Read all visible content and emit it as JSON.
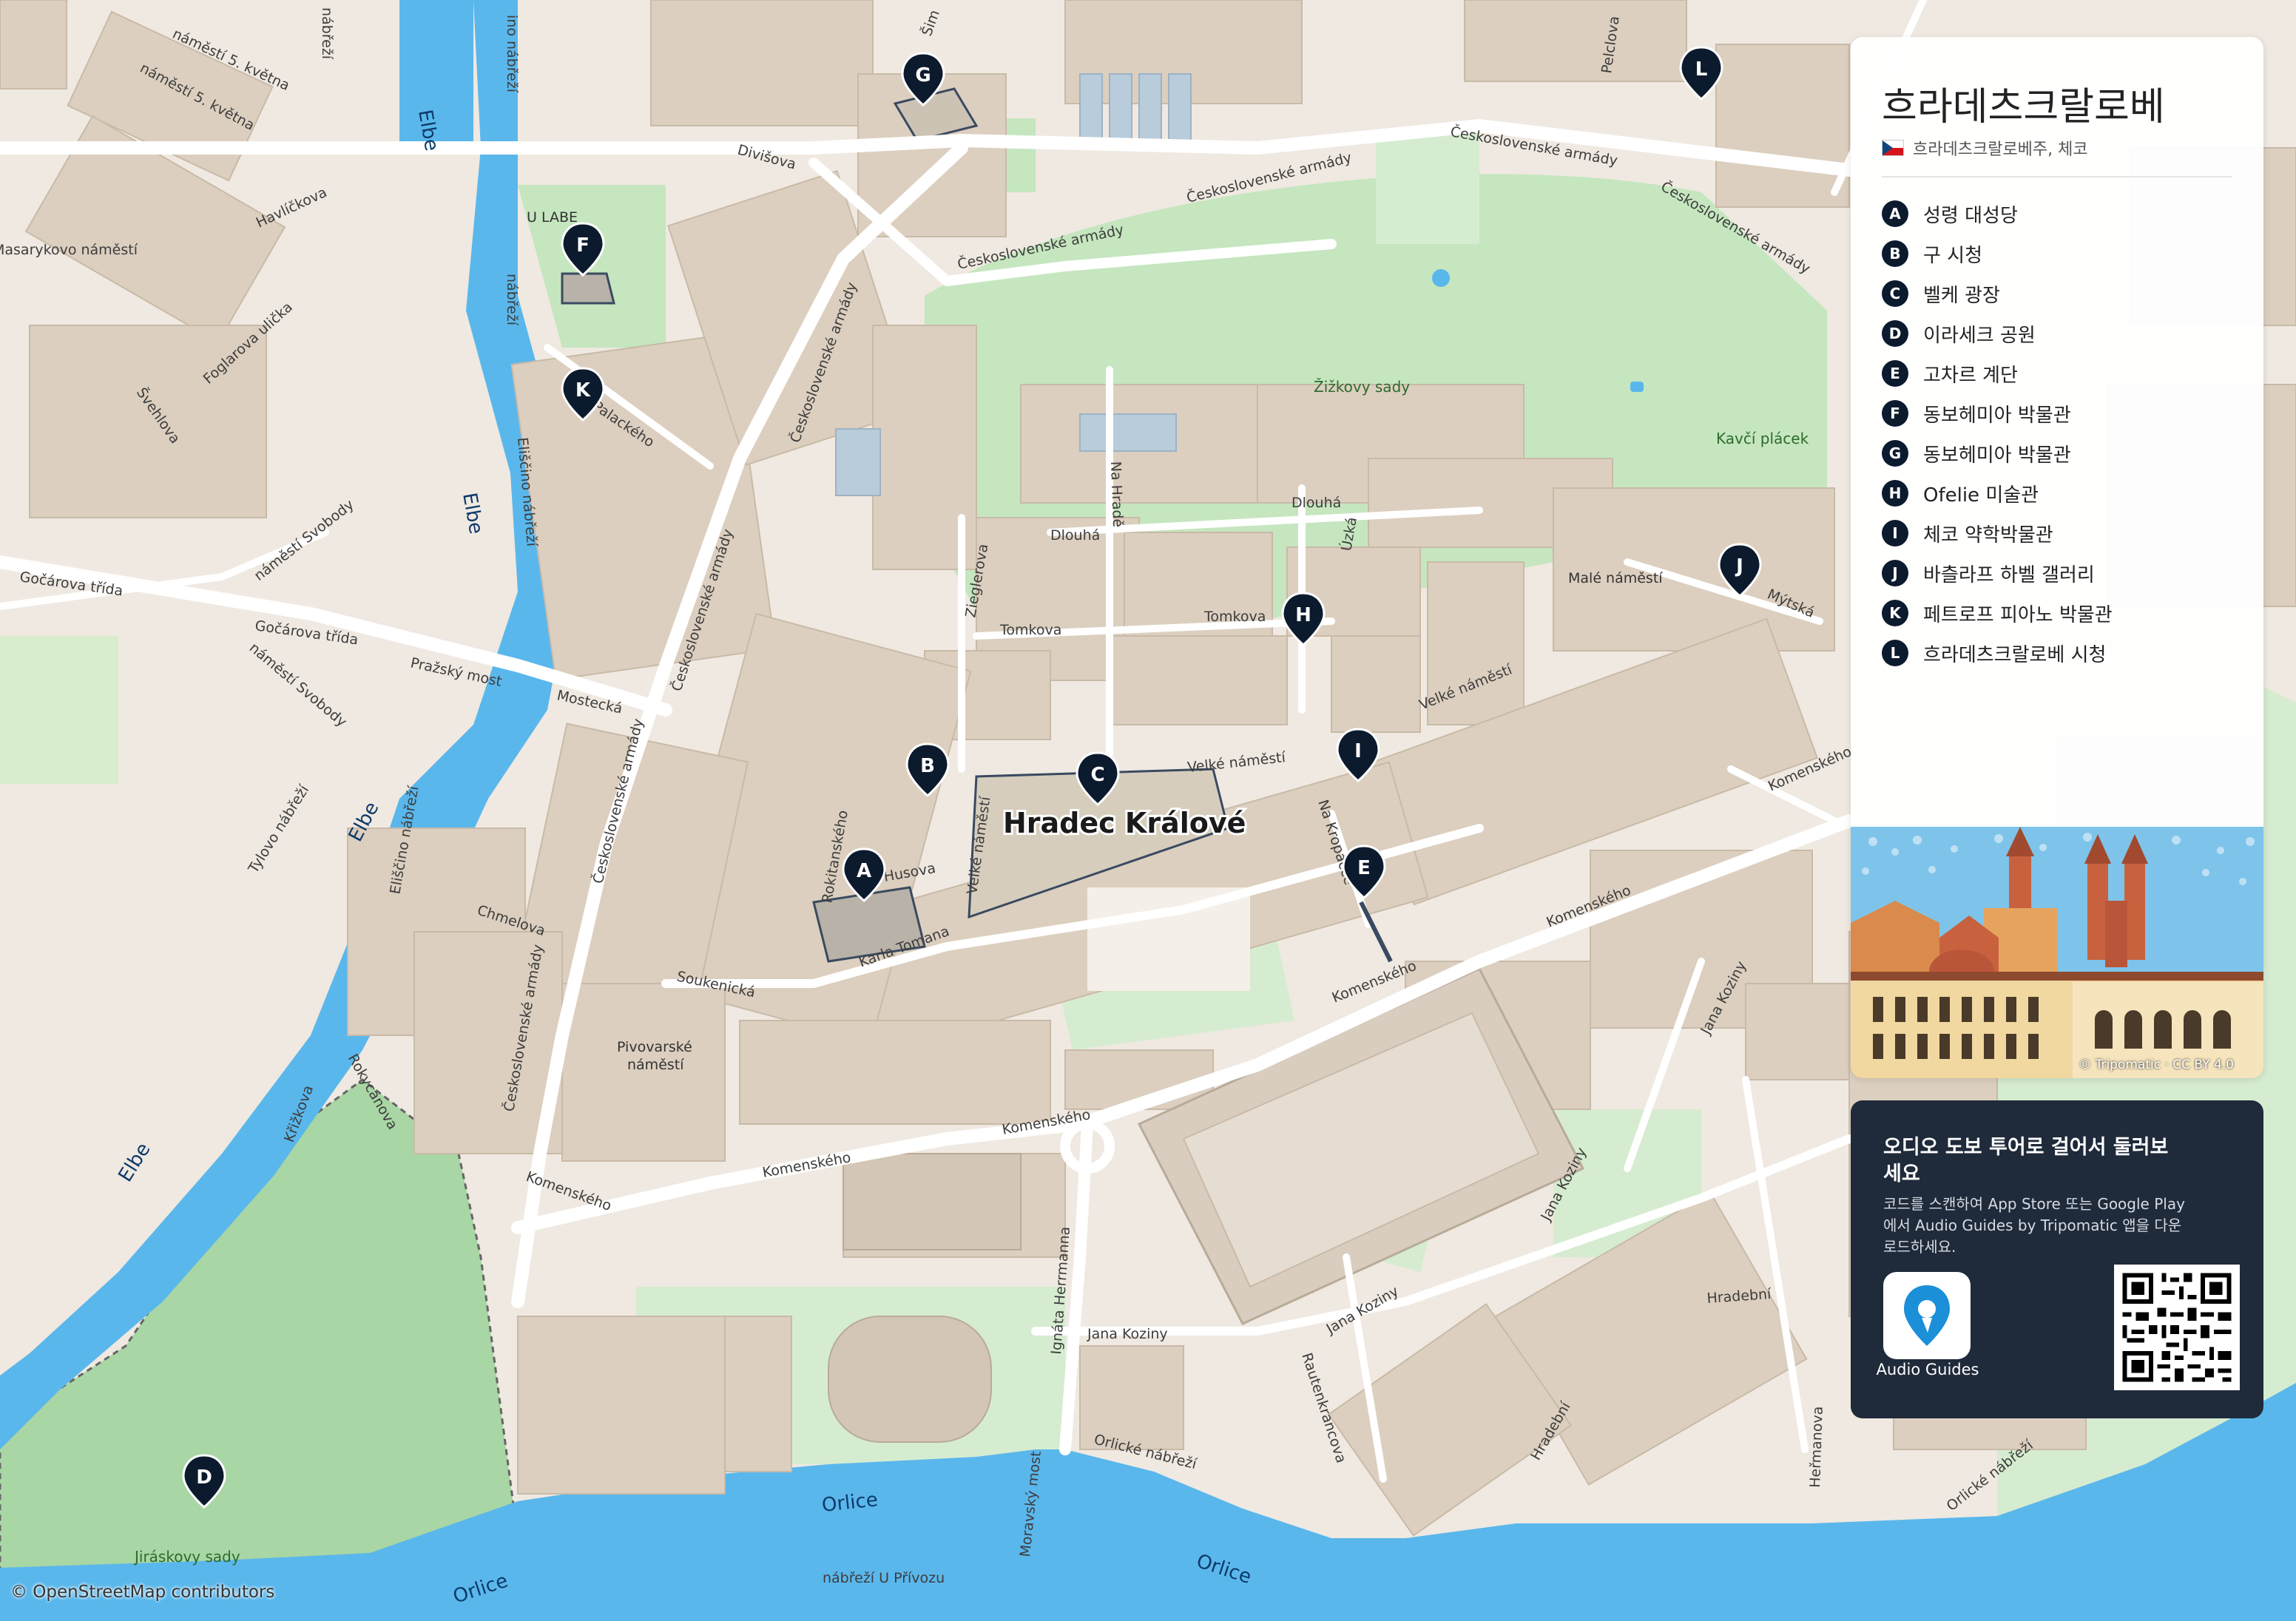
{
  "map": {
    "city_label": "Hradec Králové",
    "streets": {
      "namesti_5_kvetna_1": "náměstí 5. května",
      "namesti_5_kvetna_2": "náměstí 5. května",
      "smerova": "Šim",
      "mostni_nabrezi": "ino nábřeží",
      "mostni_2": "nábřeží",
      "divisova": "Divišova",
      "ceskoslovenske_1": "Československé armády",
      "ceskoslovenske_2": "Československé armády",
      "ceskoslovenske_3": "Československé armády",
      "ceskoslovenske_4": "Československé armády",
      "ceskoslovenske_5": "Československé armády",
      "ceskoslovenske_6": "Československé armády",
      "ceskoslovenske_7": "Československé armády",
      "ceskoslovenske_8": "Československé armády",
      "havlickova": "Havlíčkova",
      "foglarova": "Foglarova ulička",
      "svehlova": "Švehlova",
      "palackeho": "Palackého",
      "eliscino_1": "Eliščino nábřeží",
      "eliscino_2": "Eliščino nábřeží",
      "nabrezi_top": "nábřeží",
      "namesti_svobody_1": "náměstí Svobody",
      "namesti_svobody_2": "náměstí Svobody",
      "gocarova_1": "Gočárova třída",
      "gocarova_2": "Gočárova třída",
      "prazsky_most": "Pražský most",
      "mostecka": "Mostecká",
      "tylovo": "Tylovo nábřeží",
      "chmelova": "Chmelova",
      "soukenicka": "Soukenická",
      "karla_tomana": "Karla Tomana",
      "husova": "Husova",
      "rokitanskeho": "Rokitanského",
      "velke_namesti_1": "Velké náměstí",
      "velke_namesti_2": "Velké náměstí",
      "velke_namesti_3": "Velké náměstí",
      "zieglerova": "Zieglerova",
      "na_hrade": "Na Hradě",
      "dlouha_1": "Dlouhá",
      "dlouha_2": "Dlouhá",
      "uzka": "Úzká",
      "tomkova_1": "Tomkova",
      "tomkova_2": "Tomkova",
      "na_kropacce": "Na Kropáčce",
      "mytska": "Mýtská",
      "komenskeho_1": "Komenského",
      "komenskeho_2": "Komenského",
      "komenskeho_3": "Komenského",
      "komenskeho_4": "Komenského",
      "komenskeho_5": "Komenského",
      "komenskeho_6": "Komenského",
      "rokycanova": "Rokycanova",
      "krizkova": "Křižkova",
      "jana_koziny_1": "Jana Koziny",
      "jana_koziny_2": "Jana Koziny",
      "jana_koziny_3": "Jana Koziny",
      "jana_koziny_4": "Jana Koziny",
      "ignata_herrmanna": "Ignáta Herrmanna",
      "rautenkrancova": "Rautenkrancova",
      "hradebni_1": "Hradební",
      "hradebni_2": "Hradební",
      "orlicke_1": "Orlické nábřeží",
      "orlicke_2": "Orlické nábřeží",
      "hermanova": "Heřmanova",
      "moravsky_most": "Moravský most",
      "nabrezi_u_privozu": "nábřeží U Přívozu",
      "pelclova": "Pelclova",
      "masarykovo": "Masarykovo náměstí"
    },
    "water": {
      "elbe_1": "Elbe",
      "elbe_2": "Elbe",
      "elbe_3": "Elbe",
      "elbe_4": "Elbe",
      "orlice_1": "Orlice",
      "orlice_2": "Orlice",
      "orlice_3": "Orlice"
    },
    "places": {
      "u_labe": "U LABE",
      "zizkovy_sady": "Žižkovy sady",
      "kavci_placek": "Kavčí plácek",
      "male_namesti": "Malé náměstí",
      "pivovarske_1": "Pivovarské",
      "pivovarske_2": "náměstí",
      "jiraskovy_sady": "Jiráskovy sady"
    },
    "pins": [
      "A",
      "B",
      "C",
      "D",
      "E",
      "F",
      "G",
      "H",
      "I",
      "J",
      "K",
      "L"
    ]
  },
  "sidebar": {
    "title": "흐라데츠크랄로베",
    "subtitle": "흐라데츠크랄로베주, 체코",
    "country_flag": "czech-flag",
    "pois": [
      {
        "letter": "A",
        "name": "성령 대성당"
      },
      {
        "letter": "B",
        "name": "구 시청"
      },
      {
        "letter": "C",
        "name": "벨케 광장"
      },
      {
        "letter": "D",
        "name": "이라세크 공원"
      },
      {
        "letter": "E",
        "name": "고차르 계단"
      },
      {
        "letter": "F",
        "name": "동보헤미아 박물관"
      },
      {
        "letter": "G",
        "name": "동보헤미아 박물관"
      },
      {
        "letter": "H",
        "name": "Ofelie 미술관"
      },
      {
        "letter": "I",
        "name": "체코 약학박물관"
      },
      {
        "letter": "J",
        "name": "바츨라프 하벨 갤러리"
      },
      {
        "letter": "K",
        "name": "페트로프 피아노 박물관"
      },
      {
        "letter": "L",
        "name": "흐라데츠크랄로베 시청"
      }
    ],
    "illustration_credit": "© Tripomatic · CC BY 4.0"
  },
  "audio_card": {
    "title": "오디오 도보 투어로 걸어서 둘러보세요",
    "description": "코드를 스캔하여 App Store 또는 Google Play에서 Audio Guides by Tripomatic 앱을 다운로드하세요.",
    "app_label": "Audio Guides",
    "app_icon": "audio-guides-app-icon",
    "qr_icon": "qr-code"
  },
  "footer": {
    "osm_credit": "© OpenStreetMap contributors"
  },
  "colors": {
    "water": "#5ab7ec",
    "park": "#b6e2b0",
    "land": "#efe9e1",
    "building": "#d9cdbf",
    "pin": "#0c1a2e",
    "card": "#1f2a3a"
  }
}
